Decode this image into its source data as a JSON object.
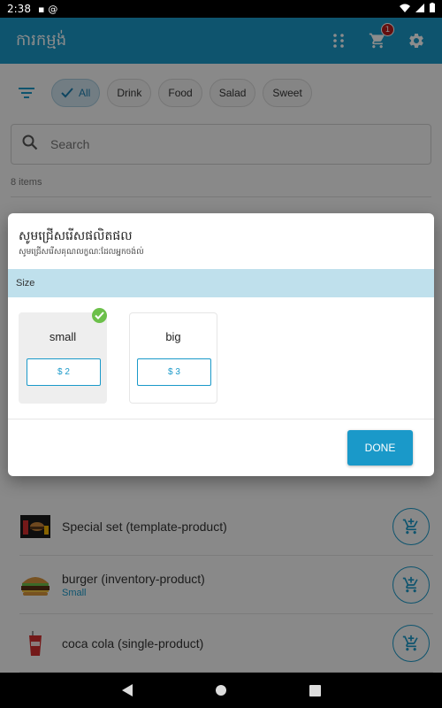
{
  "status_bar": {
    "time": "2:38"
  },
  "app_bar": {
    "title": "ការកម្មង់",
    "cart_count": "1"
  },
  "filters": {
    "chips": [
      "All",
      "Drink",
      "Food",
      "Salad",
      "Sweet"
    ],
    "selected": "All"
  },
  "search": {
    "placeholder": "Search"
  },
  "list": {
    "count_label": "8 items",
    "products": [
      {
        "name": "Special set (template-product)",
        "variant": ""
      },
      {
        "name": "burger (inventory-product)",
        "variant": "Small"
      },
      {
        "name": "coca cola (single-product)",
        "variant": ""
      }
    ]
  },
  "dialog": {
    "title": "សូមជ្រើសរើសផលិតផល",
    "subtitle": "សូមជ្រើសរើសគុណលក្ខណៈដែលអ្នកចង់ល់",
    "section": "Size",
    "options": [
      {
        "name": "small",
        "price": "$ 2",
        "selected": true
      },
      {
        "name": "big",
        "price": "$ 3",
        "selected": false
      }
    ],
    "done_label": "DONE"
  },
  "colors": {
    "primary": "#1a99c9",
    "check": "#6cc04a",
    "badge": "#b71c1c",
    "section_bg": "#bfe0ec"
  }
}
